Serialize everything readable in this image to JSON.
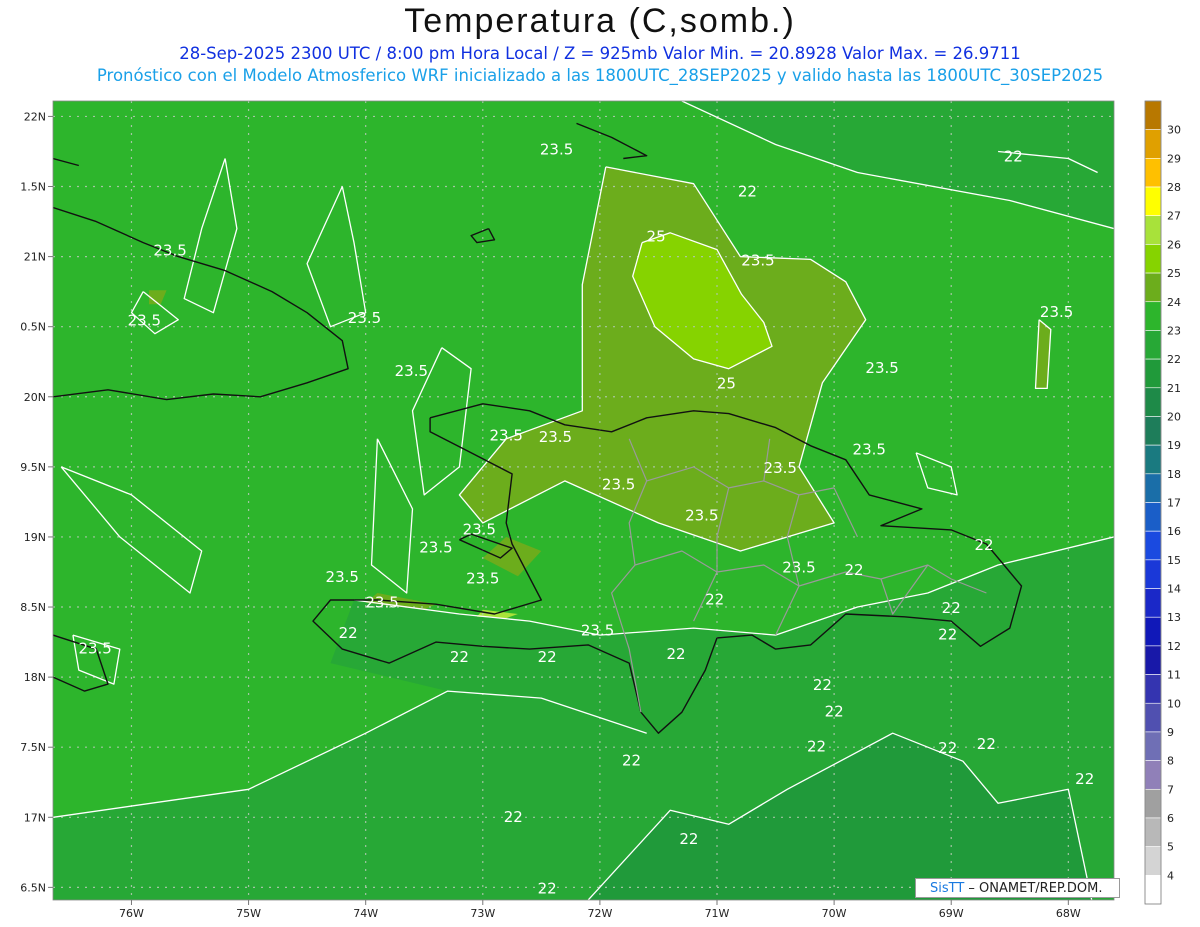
{
  "title": "Temperatura (C,somb.)",
  "subtitle_line1": "28-Sep-2025  2300 UTC / 8:00 pm Hora Local / Z = 925mb    Valor Min. = 20.8928  Valor Max. = 26.9711",
  "subtitle_line2": "Pronóstico con el Modelo Atmosferico WRF inicializado a las 1800UTC_28SEP2025 y valido hasta las  1800UTC_30SEP2025",
  "credit": {
    "brand": "SisTT",
    "org": " – ONAMET/REP.DOM."
  },
  "map": {
    "lon_range": [
      -76.67,
      -67.61
    ],
    "lat_range": [
      16.41,
      22.11
    ],
    "lon_ticks": [
      {
        "value": -76,
        "label": "76W"
      },
      {
        "value": -75,
        "label": "75W"
      },
      {
        "value": -74,
        "label": "74W"
      },
      {
        "value": -73,
        "label": "73W"
      },
      {
        "value": -72,
        "label": "72W"
      },
      {
        "value": -71,
        "label": "71W"
      },
      {
        "value": -70,
        "label": "70W"
      },
      {
        "value": -69,
        "label": "69W"
      },
      {
        "value": -68,
        "label": "68W"
      }
    ],
    "lat_ticks": [
      {
        "value": 22,
        "label": "22N"
      },
      {
        "value": 21.5,
        "label": "1.5N"
      },
      {
        "value": 21,
        "label": "21N"
      },
      {
        "value": 20.5,
        "label": "0.5N"
      },
      {
        "value": 20,
        "label": "20N"
      },
      {
        "value": 19.5,
        "label": "9.5N"
      },
      {
        "value": 19,
        "label": "19N"
      },
      {
        "value": 18.5,
        "label": "8.5N"
      },
      {
        "value": 18,
        "label": "18N"
      },
      {
        "value": 17.5,
        "label": "7.5N"
      },
      {
        "value": 17,
        "label": "17N"
      },
      {
        "value": 16.5,
        "label": "6.5N"
      }
    ],
    "colors": {
      "c21": "#209a3a",
      "c22": "#27a836",
      "c23": "#2db52c",
      "c24": "#6cad1c",
      "c25": "#86d300",
      "c26": "#a8e23a"
    },
    "contour_labels": [
      {
        "text": "23.5",
        "lon": -72.37,
        "lat": 21.76
      },
      {
        "text": "22",
        "lon": -70.74,
        "lat": 21.46
      },
      {
        "text": "22",
        "lon": -68.47,
        "lat": 21.71
      },
      {
        "text": "25",
        "lon": -71.52,
        "lat": 21.14
      },
      {
        "text": "23.5",
        "lon": -70.65,
        "lat": 20.97
      },
      {
        "text": "23.5",
        "lon": -75.67,
        "lat": 21.04
      },
      {
        "text": "23.5",
        "lon": -75.89,
        "lat": 20.54
      },
      {
        "text": "23.5",
        "lon": -74.01,
        "lat": 20.56
      },
      {
        "text": "23.5",
        "lon": -68.1,
        "lat": 20.6
      },
      {
        "text": "23.5",
        "lon": -73.61,
        "lat": 20.18
      },
      {
        "text": "25",
        "lon": -70.92,
        "lat": 20.09
      },
      {
        "text": "23.5",
        "lon": -69.59,
        "lat": 20.2
      },
      {
        "text": "23.5",
        "lon": -72.8,
        "lat": 19.72
      },
      {
        "text": "23.5",
        "lon": -72.38,
        "lat": 19.71
      },
      {
        "text": "23.5",
        "lon": -70.46,
        "lat": 19.49
      },
      {
        "text": "23.5",
        "lon": -69.7,
        "lat": 19.62
      },
      {
        "text": "23.5",
        "lon": -71.84,
        "lat": 19.37
      },
      {
        "text": "23.5",
        "lon": -71.13,
        "lat": 19.15
      },
      {
        "text": "23.5",
        "lon": -73.03,
        "lat": 19.05
      },
      {
        "text": "23.5",
        "lon": -73.4,
        "lat": 18.92
      },
      {
        "text": "23.5",
        "lon": -73.0,
        "lat": 18.7
      },
      {
        "text": "22",
        "lon": -68.72,
        "lat": 18.94
      },
      {
        "text": "23.5",
        "lon": -74.2,
        "lat": 18.71
      },
      {
        "text": "23.5",
        "lon": -70.3,
        "lat": 18.78
      },
      {
        "text": "22",
        "lon": -69.83,
        "lat": 18.76
      },
      {
        "text": "23.5",
        "lon": -73.86,
        "lat": 18.53
      },
      {
        "text": "22",
        "lon": -71.02,
        "lat": 18.55
      },
      {
        "text": "22",
        "lon": -69.0,
        "lat": 18.49
      },
      {
        "text": "22",
        "lon": -74.15,
        "lat": 18.31
      },
      {
        "text": "23.5",
        "lon": -72.02,
        "lat": 18.33
      },
      {
        "text": "22",
        "lon": -69.03,
        "lat": 18.3
      },
      {
        "text": "22",
        "lon": -73.2,
        "lat": 18.14
      },
      {
        "text": "22",
        "lon": -72.45,
        "lat": 18.14
      },
      {
        "text": "22",
        "lon": -71.35,
        "lat": 18.16
      },
      {
        "text": "23.5",
        "lon": -76.31,
        "lat": 18.2
      },
      {
        "text": "22",
        "lon": -70.1,
        "lat": 17.94
      },
      {
        "text": "22",
        "lon": -70.0,
        "lat": 17.75
      },
      {
        "text": "22",
        "lon": -69.03,
        "lat": 17.49
      },
      {
        "text": "22",
        "lon": -68.7,
        "lat": 17.52
      },
      {
        "text": "22",
        "lon": -71.73,
        "lat": 17.4
      },
      {
        "text": "22",
        "lon": -70.15,
        "lat": 17.5
      },
      {
        "text": "22",
        "lon": -67.86,
        "lat": 17.27
      },
      {
        "text": "22",
        "lon": -72.74,
        "lat": 17.0
      },
      {
        "text": "22",
        "lon": -71.24,
        "lat": 16.84
      },
      {
        "text": "22",
        "lon": -72.45,
        "lat": 16.49
      }
    ]
  },
  "colorbar": {
    "levels": [
      {
        "label": "30",
        "color": "#b87800"
      },
      {
        "label": "29",
        "color": "#e0a000"
      },
      {
        "label": "28",
        "color": "#ffc000"
      },
      {
        "label": "27",
        "color": "#ffff00"
      },
      {
        "label": "26",
        "color": "#a8e23a"
      },
      {
        "label": "25",
        "color": "#86d300"
      },
      {
        "label": "24",
        "color": "#6cad1c"
      },
      {
        "label": "23",
        "color": "#2db52c"
      },
      {
        "label": "22",
        "color": "#27a836"
      },
      {
        "label": "21",
        "color": "#209a3a"
      },
      {
        "label": "20",
        "color": "#1e8a48"
      },
      {
        "label": "19",
        "color": "#1e7d5a"
      },
      {
        "label": "18",
        "color": "#1a7a80"
      },
      {
        "label": "17",
        "color": "#1a6ea8"
      },
      {
        "label": "16",
        "color": "#1a5ec8"
      },
      {
        "label": "15",
        "color": "#1a4ae0"
      },
      {
        "label": "14",
        "color": "#1a38d8"
      },
      {
        "label": "13",
        "color": "#1a28c8"
      },
      {
        "label": "12",
        "color": "#1018b8"
      },
      {
        "label": "11",
        "color": "#1818a8"
      },
      {
        "label": "10",
        "color": "#3434b0"
      },
      {
        "label": "9",
        "color": "#5050b0"
      },
      {
        "label": "8",
        "color": "#6f6fb5"
      },
      {
        "label": "7",
        "color": "#9080b8"
      },
      {
        "label": "6",
        "color": "#a0a0a0"
      },
      {
        "label": "5",
        "color": "#b8b8b8"
      },
      {
        "label": "4",
        "color": "#d4d4d4"
      },
      {
        "label": "",
        "color": "#ffffff"
      }
    ]
  }
}
